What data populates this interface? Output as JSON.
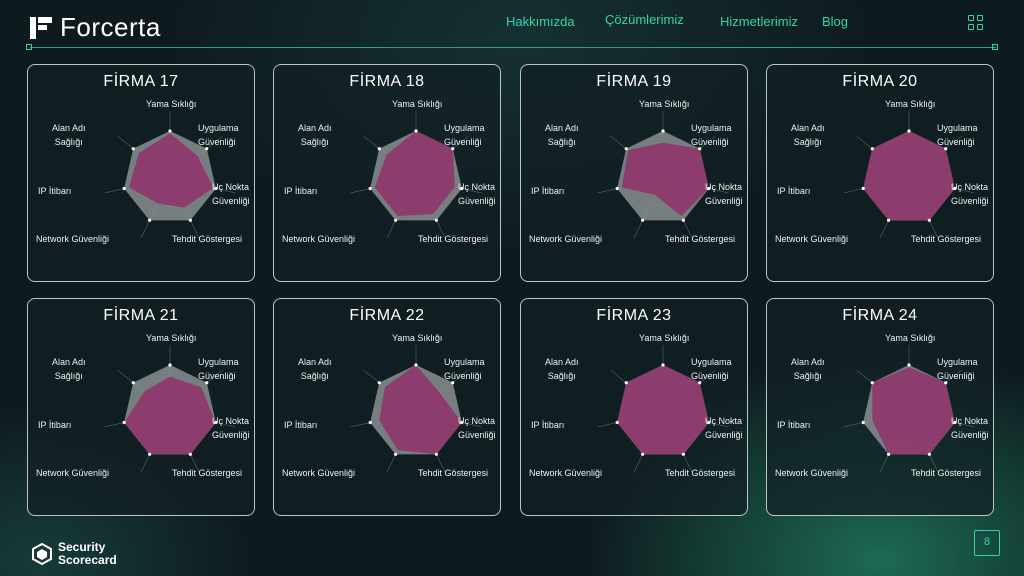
{
  "header": {
    "brand": "Forcerta",
    "nav": [
      "Hakkımızda",
      "Çözümlerimiz",
      "Hizmetlerimiz",
      "Blog"
    ],
    "icon": "grid-icon"
  },
  "axes": [
    "Yama Sıklığı",
    "Uygulama Güvenliği",
    "Uç Nokta Güvenliği",
    "Tehdit Göstergesi",
    "Network Güvenliği",
    "IP İtibarı",
    "Alan Adı Sağlığı"
  ],
  "axis_label_lines": [
    [
      "Yama Sıklığı"
    ],
    [
      "Uygulama",
      "Güvenliği"
    ],
    [
      "Uç Nokta",
      "Güvenliği"
    ],
    [
      "Tehdit Göstergesi"
    ],
    [
      "Network Güvenliği"
    ],
    [
      "IP İtibarı"
    ],
    [
      "Alan Adı",
      "Sağlığı"
    ]
  ],
  "colors": {
    "score": "#8e3a6c",
    "baseline": "#8a8f90",
    "accent": "#33d3b0"
  },
  "chart_data": [
    {
      "type": "radar",
      "title": "FİRMA 17",
      "values": [
        0.95,
        0.75,
        0.95,
        0.7,
        0.6,
        0.9,
        0.85
      ],
      "baseline": [
        1,
        1,
        1,
        1,
        1,
        1,
        1
      ]
    },
    {
      "type": "radar",
      "title": "FİRMA 18",
      "values": [
        1.0,
        1.0,
        0.85,
        0.85,
        0.9,
        0.9,
        0.8
      ],
      "baseline": [
        1,
        1,
        1,
        1,
        1,
        1,
        1
      ]
    },
    {
      "type": "radar",
      "title": "FİRMA 19",
      "values": [
        0.75,
        1.0,
        1.0,
        0.9,
        0.4,
        0.9,
        0.95
      ],
      "baseline": [
        1,
        1,
        1,
        1,
        1,
        1,
        1
      ]
    },
    {
      "type": "radar",
      "title": "FİRMA 20",
      "values": [
        1,
        1,
        1,
        1,
        1,
        1,
        1
      ],
      "baseline": [
        1,
        1,
        1,
        1,
        1,
        1,
        1
      ]
    },
    {
      "type": "radar",
      "title": "FİRMA 21",
      "values": [
        0.75,
        0.85,
        1.0,
        1.0,
        1.0,
        1.0,
        0.7
      ],
      "baseline": [
        1,
        1,
        1,
        1,
        1,
        1,
        1
      ]
    },
    {
      "type": "radar",
      "title": "FİRMA 22",
      "values": [
        1.0,
        0.65,
        1.0,
        1.0,
        0.9,
        0.8,
        0.85
      ],
      "baseline": [
        1,
        1,
        1,
        1,
        1,
        1,
        1
      ]
    },
    {
      "type": "radar",
      "title": "FİRMA 23",
      "values": [
        1,
        1,
        1,
        1,
        1,
        1,
        1
      ],
      "baseline": [
        1,
        1,
        1,
        1,
        1,
        1,
        1
      ]
    },
    {
      "type": "radar",
      "title": "FİRMA 24",
      "values": [
        0.95,
        1.0,
        1.0,
        1.0,
        1.0,
        0.8,
        1.0
      ],
      "baseline": [
        1,
        1,
        1,
        1,
        1,
        1,
        1
      ]
    }
  ],
  "footer": {
    "brand_line1": "Security",
    "brand_line2": "Scorecard",
    "page": "8"
  }
}
